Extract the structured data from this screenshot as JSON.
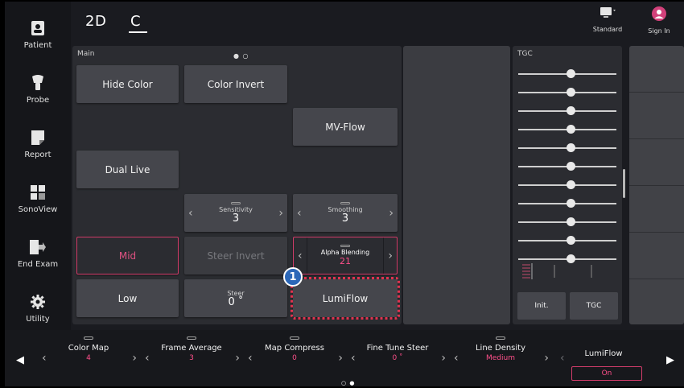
{
  "sidebar": {
    "items": [
      {
        "label": "Patient",
        "icon": "patient-card-icon"
      },
      {
        "label": "Probe",
        "icon": "probe-icon"
      },
      {
        "label": "Report",
        "icon": "report-icon"
      },
      {
        "label": "SonoView",
        "icon": "sonoview-icon"
      },
      {
        "label": "End Exam",
        "icon": "end-exam-icon"
      },
      {
        "label": "Utility",
        "icon": "gear-icon"
      }
    ]
  },
  "header": {
    "modes": [
      "2D",
      "C"
    ],
    "active_mode": "C",
    "preset_label": "Standard",
    "signin_label": "Sign In"
  },
  "main": {
    "title": "Main",
    "page_dots": "● ○",
    "buttons": {
      "hide_color": "Hide Color",
      "color_invert": "Color Invert",
      "mv_flow": "MV-Flow",
      "dual_live": "Dual Live",
      "mid": "Mid",
      "steer_invert": "Steer Invert",
      "low": "Low",
      "lumiflow": "LumiFlow"
    },
    "steppers": {
      "sensitivity": {
        "name": "Sensitivity",
        "value": "3"
      },
      "smoothing": {
        "name": "Smoothing",
        "value": "3"
      },
      "alpha_blending": {
        "name": "Alpha Blending",
        "value": "21"
      },
      "steer": {
        "name": "Steer",
        "value": "0 ˚"
      }
    },
    "callout_number": "1"
  },
  "tgc": {
    "title": "TGC",
    "slider_levels": [
      0.5,
      0.5,
      0.5,
      0.5,
      0.5,
      0.5,
      0.5,
      0.5,
      0.5,
      0.5,
      0.5
    ],
    "init_label": "Init.",
    "tgc_label": "TGC"
  },
  "bottom_bar": {
    "controls": [
      {
        "name": "Color Map",
        "value": "4"
      },
      {
        "name": "Frame Average",
        "value": "3"
      },
      {
        "name": "Map Compress",
        "value": "0"
      },
      {
        "name": "Fine Tune Steer",
        "value": "0 ˚"
      },
      {
        "name": "Line Density",
        "value": "Medium"
      }
    ],
    "lumiflow": {
      "name": "LumiFlow",
      "value": "On"
    },
    "page_dots": "○ ●"
  },
  "colors": {
    "accent_pink": "#ff4f8a",
    "highlight_red": "#e0334f",
    "callout_blue": "#2b67b8"
  }
}
